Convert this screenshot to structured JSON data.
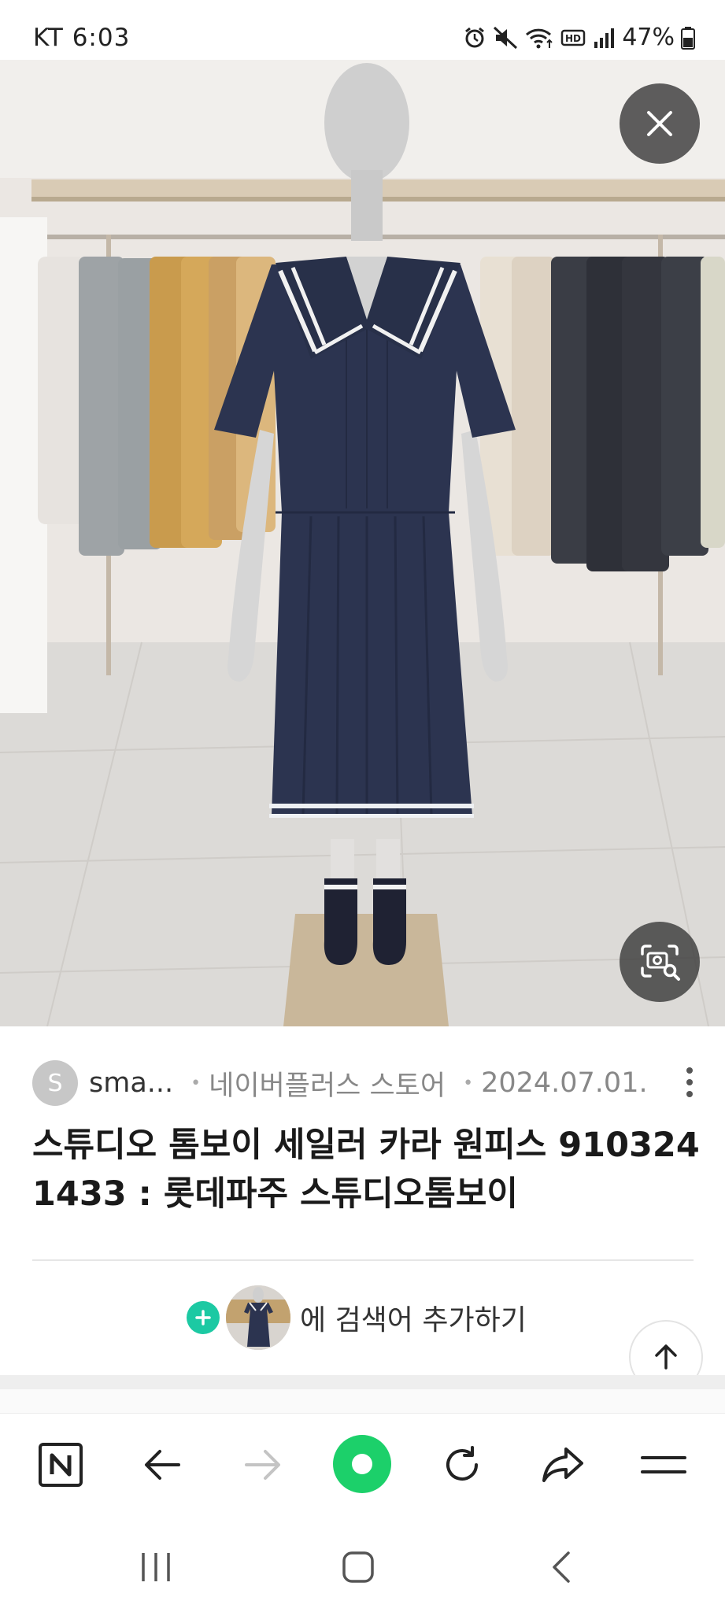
{
  "status_bar": {
    "carrier_time": "KT 6:03",
    "battery": "47%",
    "icons": [
      "alarm-icon",
      "mute-icon",
      "wifi-icon",
      "hd-icon",
      "signal-icon",
      "battery-icon"
    ]
  },
  "image_viewer": {
    "close_icon": "close-icon",
    "lens_icon": "image-search-icon"
  },
  "result": {
    "source_initial": "S",
    "source_name": "sma...",
    "store": "네이버플러스 스토어",
    "date": "2024.07.01.",
    "title": "스튜디오 톰보이 세일러 카라 원피스 9103241433 : 롯데파주 스튜디오톰보이"
  },
  "add_keyword": {
    "label": "에 검색어 추가하기"
  },
  "browser_toolbar": {
    "items": [
      "naver-home-icon",
      "back-icon",
      "forward-icon",
      "green-dot-icon",
      "refresh-icon",
      "share-icon",
      "menu-icon"
    ]
  },
  "system_nav": {
    "items": [
      "recent-apps-icon",
      "home-icon",
      "back-icon"
    ]
  },
  "colors": {
    "accent_green": "#1cc9a3",
    "dress_navy": "#2c3450"
  }
}
